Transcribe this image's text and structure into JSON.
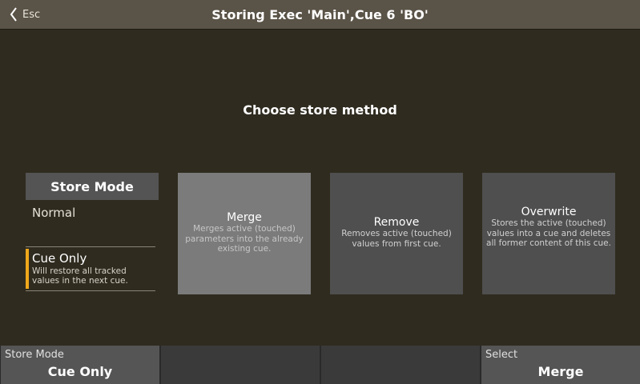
{
  "header": {
    "esc_label": "Esc",
    "title": "Storing Exec 'Main',Cue 6 'BO'"
  },
  "heading": "Choose store method",
  "store_mode": {
    "label": "Store Mode",
    "value": "Normal",
    "option": {
      "title": "Cue Only",
      "description": "Will restore all tracked values in the next cue."
    }
  },
  "methods": [
    {
      "title": "Merge",
      "description": "Merges active (touched) parameters into the already existing cue.",
      "selected": true
    },
    {
      "title": "Remove",
      "description": "Removes active (touched) values from first cue.",
      "selected": false
    },
    {
      "title": "Overwrite",
      "description": "Stores the active (touched) values into a cue and deletes all former content of this cue.",
      "selected": false
    }
  ],
  "softkeys": [
    {
      "label": "Store Mode",
      "value": "Cue Only"
    },
    {
      "label": "",
      "value": ""
    },
    {
      "label": "",
      "value": ""
    },
    {
      "label": "Select",
      "value": "Merge"
    }
  ],
  "colors": {
    "background": "#2f2b1f",
    "titlebar": "#5a5347",
    "accent": "#f0a81a",
    "selected_method": "#7b7b7b",
    "method": "#4f4f4f"
  },
  "icons": {
    "back": "chevron-left-icon"
  }
}
